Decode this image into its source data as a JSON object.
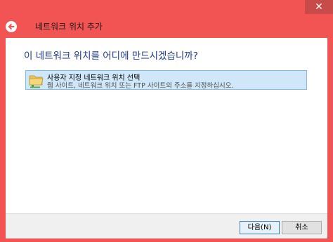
{
  "window": {
    "close_glyph": "✕",
    "accent": "#f25453"
  },
  "header": {
    "back_icon": "back-arrow-icon",
    "title": "네트워크 위치 추가"
  },
  "main": {
    "question": "이 네트워크 위치를 어디에 만드시겠습니까?",
    "options": [
      {
        "icon": "network-folder-icon",
        "title": "사용자 지정 네트워크 위치 선택",
        "description": "웹 사이트, 네트워크 위치 또는 FTP 사이트의 주소를 지정하십시오."
      }
    ]
  },
  "footer": {
    "next_label": "다음(N)",
    "cancel_label": "취소"
  }
}
